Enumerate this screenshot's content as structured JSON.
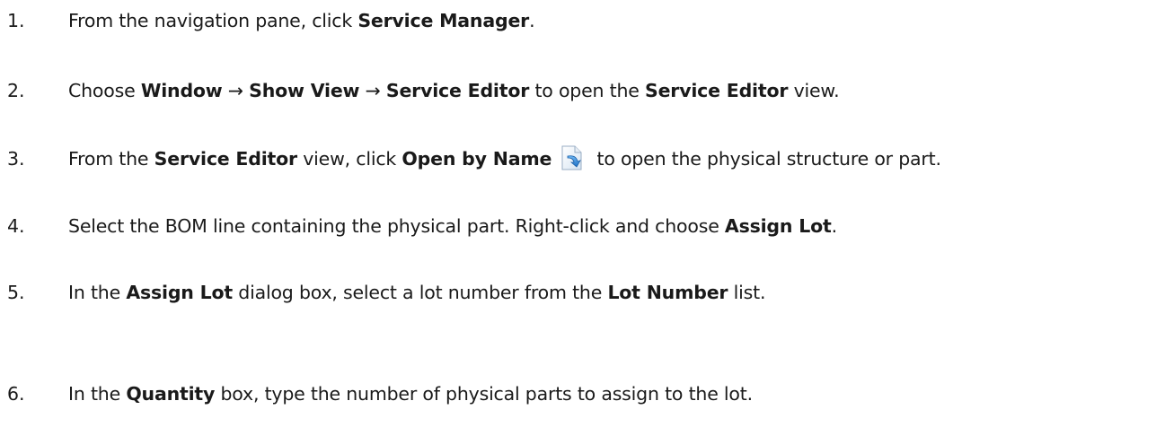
{
  "steps": [
    {
      "number": "1.",
      "parts": [
        "From the navigation pane, click ",
        "Service Manager",
        "."
      ]
    },
    {
      "number": "2.",
      "parts": [
        "Choose ",
        "Window",
        " → ",
        "Show View",
        " → ",
        "Service Editor",
        " to open the ",
        "Service Editor",
        " view."
      ]
    },
    {
      "number": "3.",
      "parts": [
        "From the ",
        "Service Editor",
        " view, click ",
        "Open by Name",
        " to open the physical structure or part."
      ],
      "icon": "open-by-name-icon"
    },
    {
      "number": "4.",
      "parts": [
        "Select the BOM line containing the physical part. Right-click and choose ",
        "Assign Lot",
        "."
      ]
    },
    {
      "number": "5.",
      "parts": [
        "In the ",
        "Assign Lot",
        " dialog box, select a lot number from the ",
        "Lot Number",
        " list."
      ]
    },
    {
      "number": "6.",
      "parts": [
        "In the ",
        "Quantity",
        " box, type the number of physical parts to assign to the lot."
      ]
    }
  ]
}
